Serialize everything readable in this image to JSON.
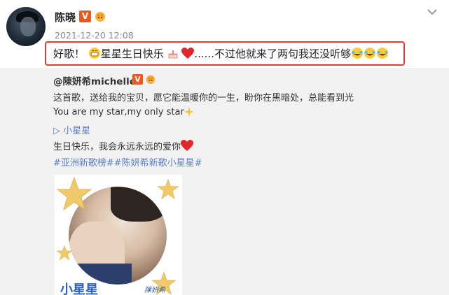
{
  "header": {
    "username": "陈晓",
    "verified_label": "V",
    "timestamp": "2021-12-20 12:08"
  },
  "post": {
    "text_part1": "好歌！",
    "text_part2": "星星生日快乐",
    "text_part3": "......不过他就来了两句我还没听够"
  },
  "repost": {
    "username": "@陳妍希michelle",
    "verified_label": "V",
    "line1": "这首歌，送给我的宝贝，愿它能温暖你的一生，盼你在黑暗处，总能看到光",
    "line2": "You are my star,my only star",
    "link": "▷ 小星星",
    "line4": "生日快乐，我会永远永远的爱你",
    "hashtags": "#亚洲新歌榜##陈妍希新歌小星星#",
    "photo_caption": "小星星",
    "photo_signature": "陳妍希"
  },
  "colors": {
    "highlight_border": "#e53c36",
    "link": "#5a7ec4",
    "repost_bg": "#f2f2f2",
    "vip_orange": "#e8581f"
  },
  "icons": [
    "chevron-down-icon",
    "crown-icon",
    "grin-emoji-icon",
    "cake-emoji-icon",
    "heart-emoji-icon",
    "laugh-cry-emoji-icon",
    "sparkle-emoji-icon",
    "star-icon"
  ]
}
